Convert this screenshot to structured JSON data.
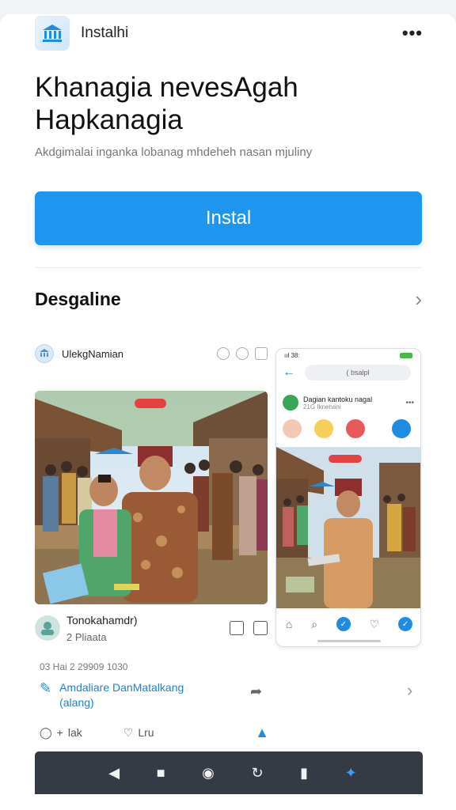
{
  "app": {
    "name": "Instalhi",
    "more_label": "•••",
    "title": "Khanagia nevesAgah Hapkanagia",
    "subtitle": "Akdgimalai inganka lobanag mhdeheh nasan mjuliny",
    "install_label": "Instal"
  },
  "section": {
    "title": "Desgaline",
    "chevron": "›"
  },
  "post": {
    "user": "UlekgNamian",
    "author_name": "Tonokahamdr)",
    "author_sub": "2  Pliaata",
    "date": "03 Hai 2 29909 1030",
    "link_text": "Amdaliare DanMatalkang (alang)",
    "link_chevron": "›",
    "like_label": "lak",
    "heart_label": "Lru"
  },
  "phone": {
    "time": "ııl 38:",
    "search": "( bsalpl",
    "post_name": "Dagian kantoku nagal",
    "post_sub": "21G Iknenani",
    "more": "•••"
  },
  "colors": {
    "accent": "#1e95ee",
    "navbar": "#353b44"
  },
  "icons": {
    "app": "bank-icon",
    "nav": [
      "back-icon",
      "home-square-icon",
      "circle-home-icon",
      "recent-icon",
      "book-icon",
      "assistant-icon"
    ]
  }
}
